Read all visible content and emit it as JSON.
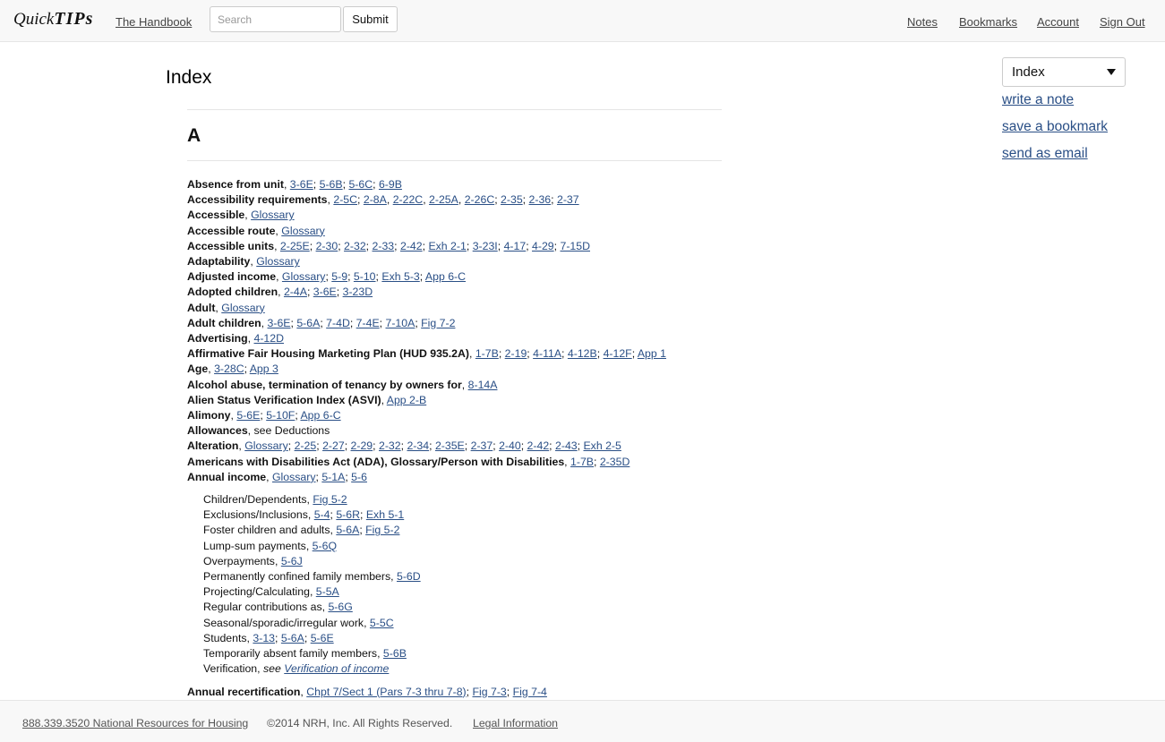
{
  "header": {
    "logo_text_1": "Quick",
    "logo_text_2": "TIPs",
    "handbook_link": "The Handbook",
    "search_placeholder": "Search",
    "submit_label": "Submit",
    "nav": [
      "Notes",
      "Bookmarks",
      "Account",
      "Sign Out"
    ]
  },
  "page": {
    "title": "Index",
    "letter": "A"
  },
  "entries": [
    {
      "term": "Absence from unit",
      "refs": [
        "3-6E",
        "5-6B",
        "5-6C",
        "6-9B"
      ]
    },
    {
      "term": "Accessibility requirements",
      "refs": [
        "2-5C",
        "2-8A",
        "2-22C",
        "2-25A",
        "2-26C",
        "2-35",
        "2-36",
        "2-37"
      ],
      "seps": [
        "; ",
        ", ",
        ", ",
        ", ",
        "; ",
        "; ",
        "; "
      ]
    },
    {
      "term": "Accessible",
      "refs": [
        "Glossary"
      ]
    },
    {
      "term": "Accessible route",
      "refs": [
        "Glossary"
      ]
    },
    {
      "term": "Accessible units",
      "refs": [
        "2-25E",
        "2-30",
        "2-32",
        "2-33",
        "2-42",
        "Exh 2-1",
        "3-23I",
        "4-17",
        "4-29",
        "7-15D"
      ]
    },
    {
      "term": "Adaptability",
      "refs": [
        "Glossary"
      ]
    },
    {
      "term": "Adjusted income",
      "refs": [
        "Glossary",
        "5-9",
        "5-10",
        "Exh 5-3",
        "App 6-C"
      ]
    },
    {
      "term": "Adopted children",
      "refs": [
        "2-4A",
        "3-6E",
        "3-23D"
      ]
    },
    {
      "term": "Adult",
      "refs": [
        "Glossary"
      ]
    },
    {
      "term": "Adult children",
      "refs": [
        "3-6E",
        "5-6A",
        "7-4D",
        "7-4E",
        "7-10A",
        "Fig 7-2"
      ]
    },
    {
      "term": "Advertising",
      "refs": [
        "4-12D"
      ]
    },
    {
      "term": "Affirmative Fair Housing Marketing Plan (HUD 935.2A)",
      "refs": [
        "1-7B",
        "2-19",
        "4-11A",
        "4-12B",
        "4-12F",
        "App 1"
      ]
    },
    {
      "term": "Age",
      "refs": [
        "3-28C",
        "App 3"
      ]
    },
    {
      "term": "Alcohol abuse, termination of tenancy by owners for",
      "refs": [
        "8-14A"
      ]
    },
    {
      "term": "Alien Status Verification Index (ASVI)",
      "refs": [
        "App 2-B"
      ]
    },
    {
      "term": "Alimony",
      "refs": [
        "5-6E",
        "5-10F",
        "App 6-C"
      ]
    },
    {
      "term": "Allowances",
      "plain": "see Deductions",
      "refs": []
    },
    {
      "term": "Alteration",
      "refs": [
        "Glossary",
        "2-25",
        "2-27",
        "2-29",
        "2-32",
        "2-34",
        "2-35E",
        "2-37",
        "2-40",
        "2-42",
        "2-43",
        "Exh 2-5"
      ]
    },
    {
      "term": "Americans with Disabilities Act (ADA), Glossary/Person with Disabilities",
      "refs": [
        "1-7B",
        "2-35D"
      ]
    },
    {
      "term": "Annual income",
      "refs": [
        "Glossary",
        "5-1A",
        "5-6"
      ],
      "subs": [
        {
          "term": "Children/Dependents",
          "refs": [
            "Fig 5-2"
          ]
        },
        {
          "term": "Exclusions/Inclusions",
          "refs": [
            "5-4",
            "5-6R",
            "Exh 5-1"
          ]
        },
        {
          "term": "Foster children and adults",
          "refs": [
            "5-6A",
            "Fig 5-2"
          ]
        },
        {
          "term": "Lump-sum payments",
          "refs": [
            "5-6Q"
          ]
        },
        {
          "term": "Overpayments",
          "refs": [
            "5-6J"
          ]
        },
        {
          "term": "Permanently confined family members",
          "refs": [
            "5-6D"
          ]
        },
        {
          "term": "Projecting/Calculating",
          "refs": [
            "5-5A"
          ]
        },
        {
          "term": "Regular contributions as",
          "refs": [
            "5-6G"
          ]
        },
        {
          "term": "Seasonal/sporadic/irregular work",
          "refs": [
            "5-5C"
          ]
        },
        {
          "term": "Students",
          "refs": [
            "3-13",
            "5-6A",
            "5-6E"
          ]
        },
        {
          "term": "Temporarily absent family members",
          "refs": [
            "5-6B"
          ]
        },
        {
          "term": "Verification",
          "see": "see",
          "see_ref": "Verification of income",
          "refs": []
        }
      ]
    },
    {
      "term": "Annual recertification",
      "refs": [
        "Chpt 7/Sect 1 (Pars 7-3 thru 7-8)",
        "Fig 7-3",
        "Fig 7-4"
      ]
    }
  ],
  "sidebar": {
    "select_value": "Index",
    "links": [
      "write a note",
      "save a bookmark",
      "send as email"
    ]
  },
  "footer": {
    "phone_link": "888.339.3520 National Resources for Housing",
    "copyright": "©2014 NRH, Inc. All Rights Reserved.",
    "legal_link": "Legal Information"
  }
}
